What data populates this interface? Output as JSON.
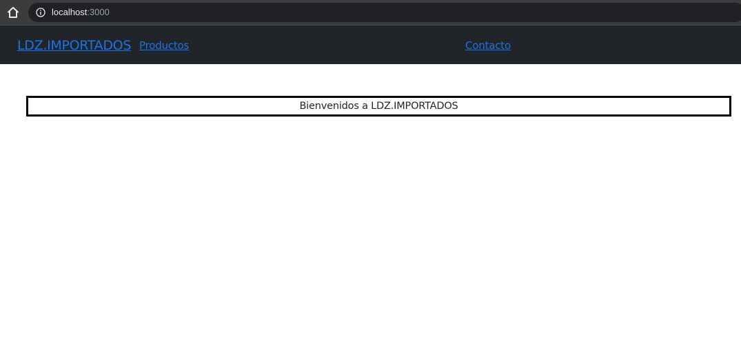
{
  "browser": {
    "home_icon": "home-icon",
    "info_icon": "info-icon",
    "url_host": "localhost",
    "url_port": ":3000"
  },
  "navbar": {
    "brand": "LDZ.IMPORTADOS",
    "links": [
      {
        "label": "Productos"
      },
      {
        "label": "Contacto"
      }
    ],
    "background_color": "#212529",
    "link_color": "#1a73e8"
  },
  "main": {
    "welcome_text": "Bienvenidos a LDZ.IMPORTADOS"
  }
}
